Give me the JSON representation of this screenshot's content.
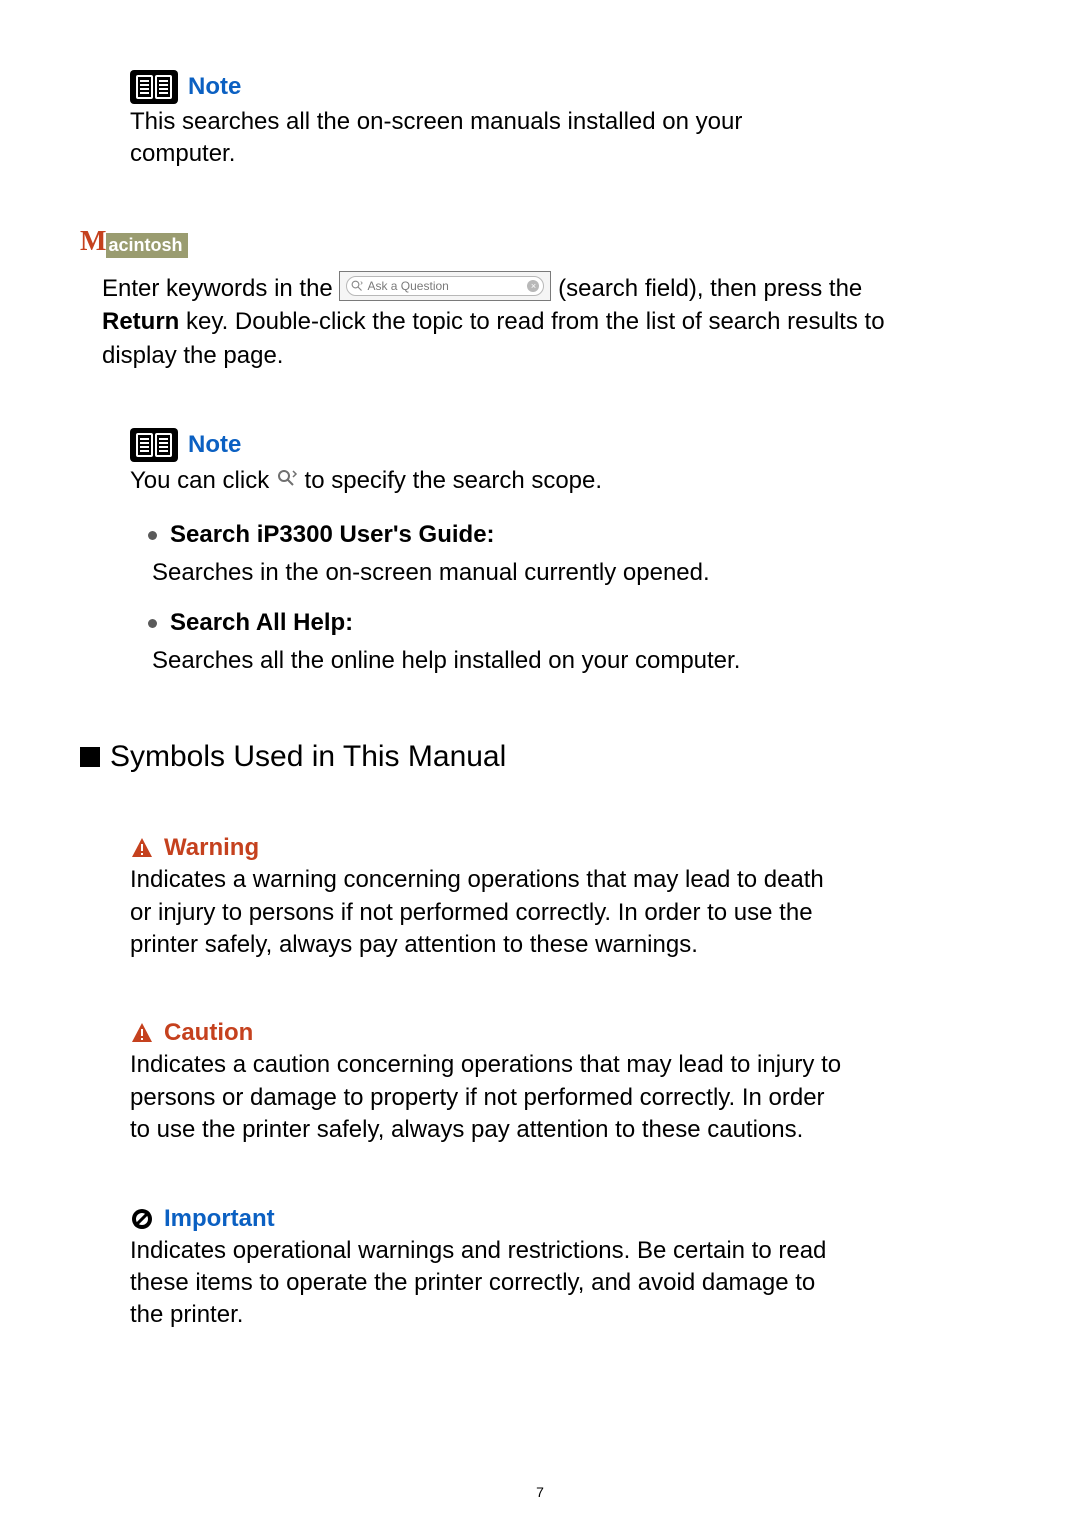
{
  "note1": {
    "label": "Note",
    "text": "This searches all the on-screen manuals installed on your computer."
  },
  "macBadge": {
    "m": "M",
    "rest": "acintosh"
  },
  "macPara": {
    "pre": "Enter keywords in the ",
    "searchPlaceholder": "Ask a Question",
    "post1": " (search field), then press the ",
    "returnWord": "Return",
    "post2": " key. Double-click the topic to read from the list of search results to display the page."
  },
  "note2": {
    "label": "Note",
    "clickText1": "You can click ",
    "clickText2": " to specify the search scope.",
    "bullets": [
      {
        "title": "Search iP3300 User's Guide:",
        "desc": "Searches in the on-screen manual currently opened."
      },
      {
        "title": "Search All Help:",
        "desc": "Searches all the online help installed on your computer."
      }
    ]
  },
  "section": {
    "title": "Symbols Used in This Manual"
  },
  "symbols": {
    "warning": {
      "label": "Warning",
      "text": "Indicates a warning concerning operations that may lead to death or injury to persons if not performed correctly. In order to use the printer safely, always pay attention to these warnings."
    },
    "caution": {
      "label": "Caution",
      "text": "Indicates a caution concerning operations that may lead to injury to persons or damage to property if not performed correctly. In order to use the printer safely, always pay attention to these cautions."
    },
    "important": {
      "label": "Important",
      "text": "Indicates operational warnings and restrictions. Be certain to read these items to operate the printer correctly, and avoid damage to the printer."
    }
  },
  "pageNumber": "7"
}
